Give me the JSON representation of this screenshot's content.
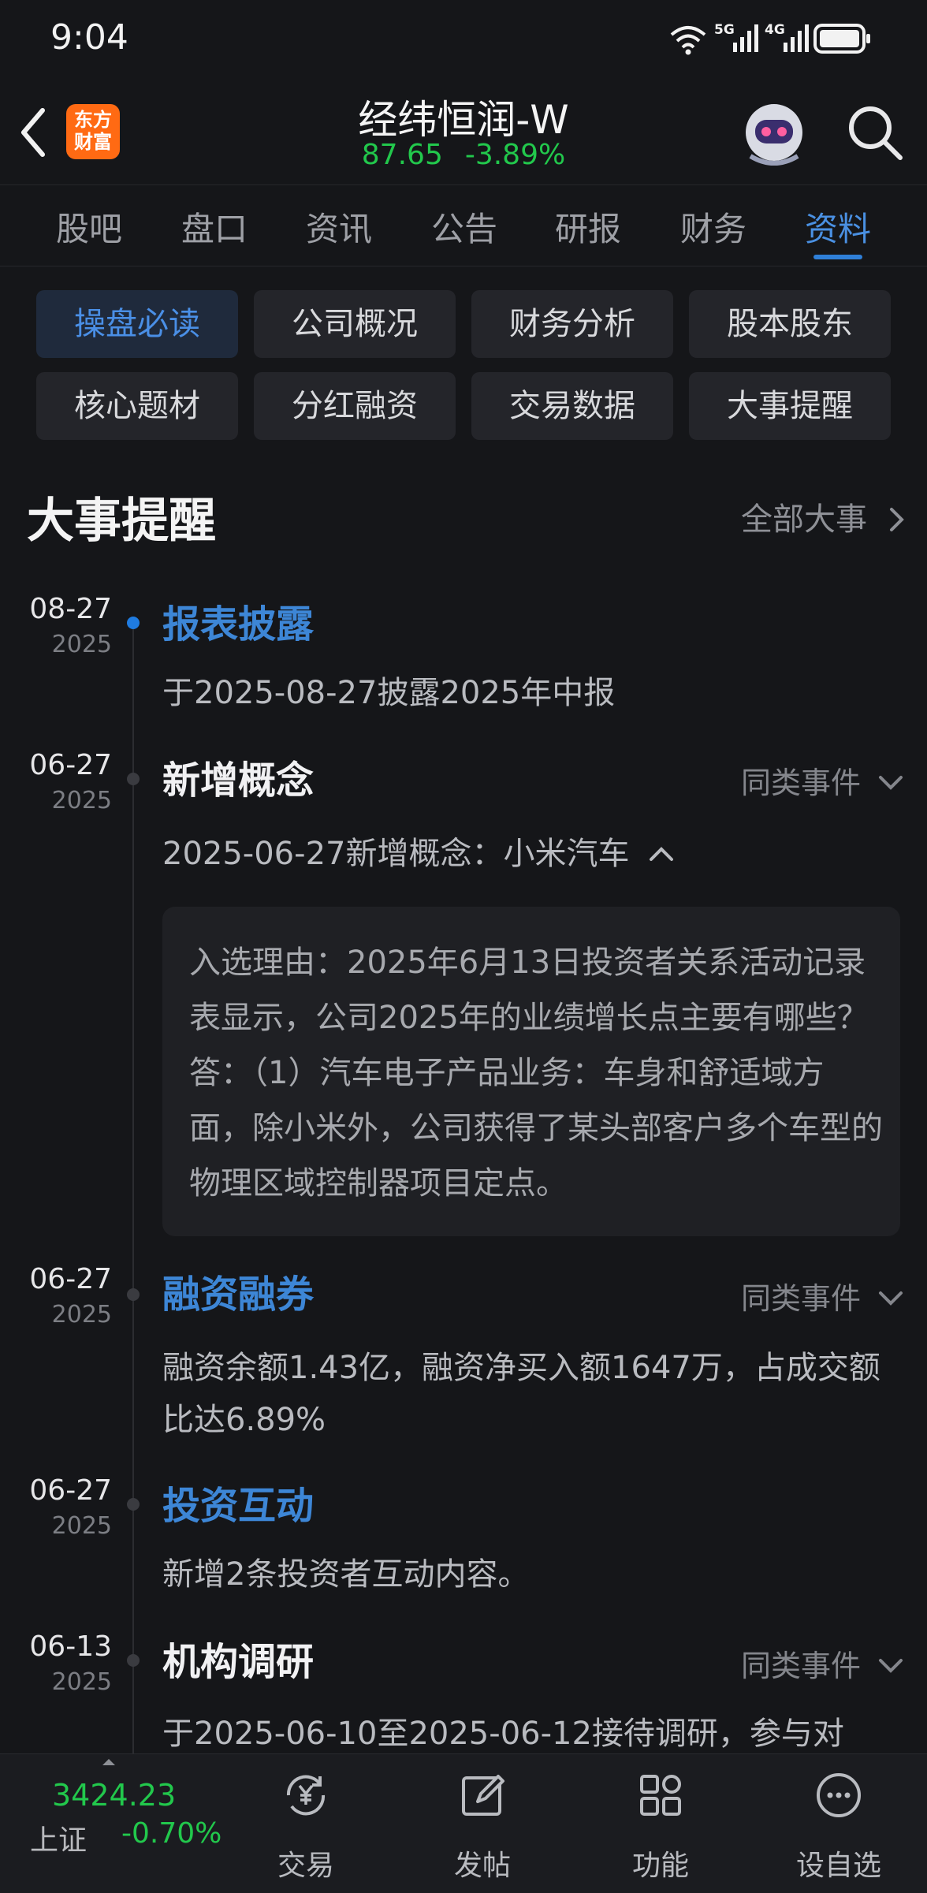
{
  "status_bar": {
    "time": "9:04",
    "sig1": "5G",
    "sig2": "4G"
  },
  "header": {
    "back_icon": "chevron-left-icon",
    "logo_line1": "东方",
    "logo_line2": "财富",
    "stock_name": "经纬恒润-W",
    "price": "87.65",
    "change_pct": "-3.89%",
    "search_icon": "search-icon",
    "colors": {
      "down": "#22c84c",
      "accent": "#2f7fd8",
      "logo": "#ff6a13"
    }
  },
  "tabs": [
    {
      "label": "股吧"
    },
    {
      "label": "盘口"
    },
    {
      "label": "资讯"
    },
    {
      "label": "公告"
    },
    {
      "label": "研报"
    },
    {
      "label": "财务"
    },
    {
      "label": "资料",
      "active": true
    }
  ],
  "chips": [
    {
      "label": "操盘必读",
      "active": true
    },
    {
      "label": "公司概况"
    },
    {
      "label": "财务分析"
    },
    {
      "label": "股本股东"
    },
    {
      "label": "核心题材"
    },
    {
      "label": "分红融资"
    },
    {
      "label": "交易数据"
    },
    {
      "label": "大事提醒"
    }
  ],
  "section": {
    "title": "大事提醒",
    "all_label": "全部大事"
  },
  "events": [
    {
      "md": "08-27",
      "year": "2025",
      "title": "报表披露",
      "similar": "",
      "desc": "于2025-08-27披露2025年中报"
    },
    {
      "md": "06-27",
      "year": "2025",
      "title": "新增概念",
      "similar": "同类事件",
      "desc": "2025-06-27新增概念：小米汽车",
      "reason": "入选理由：2025年6月13日投资者关系活动记录表显示，公司2025年的业绩增长点主要有哪些？答：（1）汽车电子产品业务：车身和舒适域方面，除小米外，公司获得了某头部客户多个车型的物理区域控制器项目定点。"
    },
    {
      "md": "06-27",
      "year": "2025",
      "title": "融资融券",
      "similar": "同类事件",
      "desc": "融资余额1.43亿，融资净买入额1647万，占成交额比达6.89%"
    },
    {
      "md": "06-27",
      "year": "2025",
      "title": "投资互动",
      "similar": "",
      "desc": "新增2条投资者互动内容。"
    },
    {
      "md": "06-13",
      "year": "2025",
      "title": "机构调研",
      "similar": "同类事件",
      "desc": "于2025-06-10至2025-06-12接待调研，参与对"
    }
  ],
  "bottom_bar": {
    "index_value": "3424.23",
    "index_name": "上证",
    "index_change": "-0.70%",
    "nav": [
      {
        "label": "交易",
        "icon": "yen-exchange-icon"
      },
      {
        "label": "发帖",
        "icon": "edit-icon"
      },
      {
        "label": "功能",
        "icon": "grid-icon"
      },
      {
        "label": "设自选",
        "icon": "more-circle-icon"
      }
    ]
  }
}
